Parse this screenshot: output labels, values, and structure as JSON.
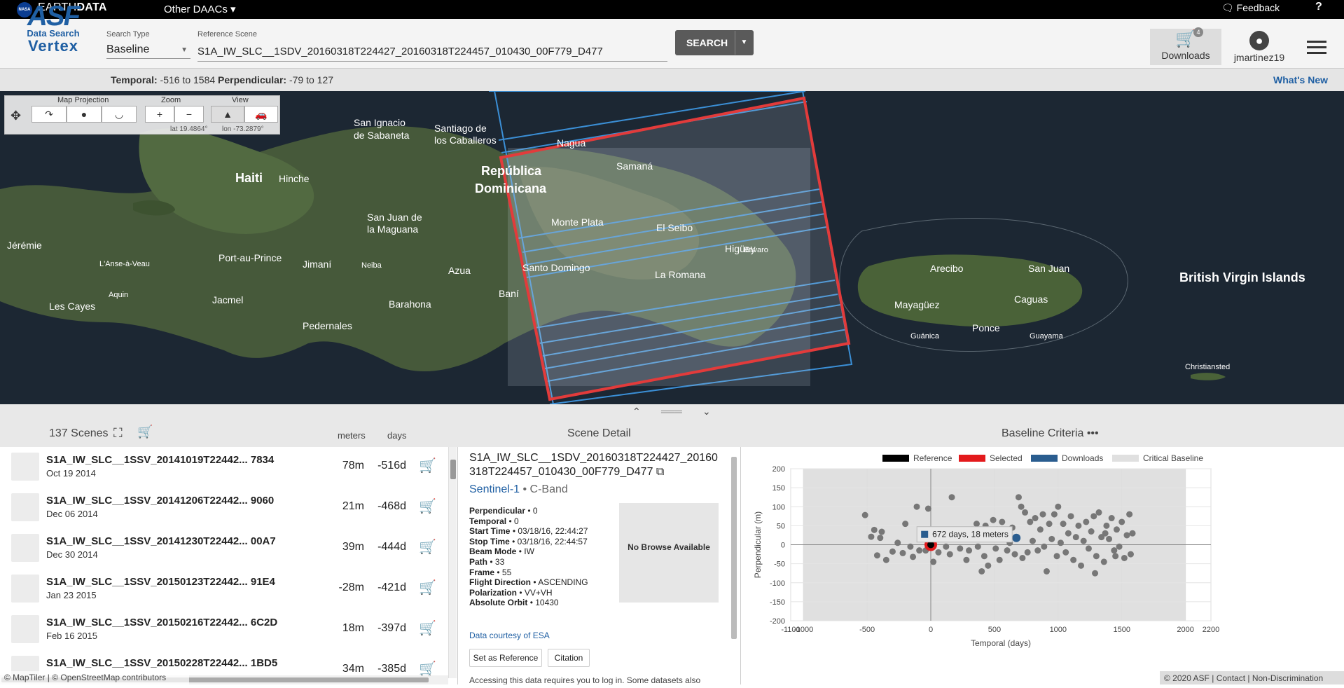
{
  "topbar": {
    "brand_prefix": "EARTH",
    "brand_suffix": "DATA",
    "other_daacs": "Other DAACs ▾",
    "feedback": "Feedback",
    "help": "?",
    "nasa": "NASA"
  },
  "logo": {
    "asf": "ASF",
    "data_search": "Data Search",
    "vertex": "Vertex"
  },
  "search": {
    "type_label": "Search Type",
    "type_value": "Baseline",
    "ref_label": "Reference Scene",
    "ref_value": "S1A_IW_SLC__1SDV_20160318T224427_20160318T224457_010430_00F779_D477",
    "search_button": "SEARCH"
  },
  "downloads": {
    "label": "Downloads",
    "count": "4"
  },
  "user": {
    "name": "jmartinez19"
  },
  "criteria": {
    "temporal_label": "Temporal:",
    "temporal_value": "-516 to 1584",
    "perp_label": "Perpendicular:",
    "perp_value": "-79 to 127",
    "whats_new": "What's New"
  },
  "map": {
    "tools": {
      "projection_label": "Map Projection",
      "zoom_label": "Zoom",
      "view_label": "View",
      "lat": "lat 19.4864°",
      "lon": "lon -73.2879°"
    },
    "places": [
      "Haiti",
      "Hinche",
      "San Ignacio de Sabaneta",
      "Santiago de los Caballeros",
      "Nagua",
      "República Dominicana",
      "Samaná",
      "Monte Plata",
      "El Seibo",
      "Higüey",
      "Bávaro",
      "La Romana",
      "Santo Domingo",
      "Azua",
      "Baní",
      "Barahona",
      "Pedernales",
      "San Juan de la Maguana",
      "Jimaní",
      "Neiba",
      "Port-au-Prince",
      "Jacmel",
      "Les Cayes",
      "Jérémie",
      "L'Anse-à-Veau",
      "Aquin",
      "Arecibo",
      "San Juan",
      "Mayagüez",
      "Caguas",
      "Ponce",
      "Guánica",
      "Guayama",
      "British Virgin Islands",
      "Christiansted"
    ],
    "attribution": "© MapTiler | © OpenStreetMap contributors"
  },
  "results": {
    "count_label": "137 Scenes",
    "col_meters": "meters",
    "col_days": "days",
    "rows": [
      {
        "name": "S1A_IW_SLC__1SSV_20141019T22442... 7834",
        "date": "Oct 19 2014",
        "meters": "78m",
        "days": "-516d"
      },
      {
        "name": "S1A_IW_SLC__1SSV_20141206T22442... 9060",
        "date": "Dec 06 2014",
        "meters": "21m",
        "days": "-468d"
      },
      {
        "name": "S1A_IW_SLC__1SSV_20141230T22442... 00A7",
        "date": "Dec 30 2014",
        "meters": "39m",
        "days": "-444d"
      },
      {
        "name": "S1A_IW_SLC__1SSV_20150123T22442... 91E4",
        "date": "Jan 23 2015",
        "meters": "-28m",
        "days": "-421d"
      },
      {
        "name": "S1A_IW_SLC__1SSV_20150216T22442... 6C2D",
        "date": "Feb 16 2015",
        "meters": "18m",
        "days": "-397d"
      },
      {
        "name": "S1A_IW_SLC__1SSV_20150228T22442... 1BD5",
        "date": "",
        "meters": "34m",
        "days": "-385d"
      }
    ]
  },
  "detail": {
    "header": "Scene Detail",
    "scene_name": "S1A_IW_SLC__1SDV_20160318T224427_20160318T224457_010430_00F779_D477",
    "dataset": "Sentinel-1",
    "band": "• C-Band",
    "fields": [
      {
        "k": "Perpendicular",
        "v": "• 0"
      },
      {
        "k": "Temporal",
        "v": "• 0"
      },
      {
        "k": "Start Time",
        "v": "• 03/18/16, 22:44:27"
      },
      {
        "k": "Stop Time",
        "v": "• 03/18/16, 22:44:57"
      },
      {
        "k": "Beam Mode",
        "v": "• IW"
      },
      {
        "k": "Path",
        "v": "• 33"
      },
      {
        "k": "Frame",
        "v": "• 55"
      },
      {
        "k": "Flight Direction",
        "v": "• ASCENDING"
      },
      {
        "k": "Polarization",
        "v": "• VV+VH"
      },
      {
        "k": "Absolute Orbit",
        "v": "• 10430"
      }
    ],
    "courtesy": "Data courtesy of ESA",
    "no_browse": "No Browse Available",
    "set_reference": "Set as Reference",
    "citation": "Citation",
    "access_note": "Accessing this data requires you to log in. Some datasets also"
  },
  "baseline": {
    "header": "Baseline Criteria •••"
  },
  "colors": {
    "reference": "#000000",
    "selected": "#e31a1c",
    "downloads": "#2a5d8f",
    "critical": "#e0e0e0",
    "accent": "#1f5fa3"
  },
  "chart_data": {
    "type": "scatter",
    "xlabel": "Temporal (days)",
    "ylabel": "Perpendicular (m)",
    "xlim": [
      -1100,
      2200
    ],
    "ylim": [
      -200,
      200
    ],
    "xticks": [
      "-1100",
      "-1000",
      "-500",
      "0",
      "500",
      "1000",
      "1500",
      "2000",
      "2200"
    ],
    "yticks": [
      "200",
      "150",
      "100",
      "50",
      "0",
      "-50",
      "-100",
      "-150",
      "-200"
    ],
    "legend": [
      "Reference",
      "Selected",
      "Downloads",
      "Critical Baseline"
    ],
    "tooltip": "672 days, 18 meters",
    "reference": {
      "x": 0,
      "y": 0
    },
    "selected": {
      "x": 0,
      "y": 0
    },
    "downloads": [
      {
        "x": 672,
        "y": 18
      }
    ],
    "points": [
      [
        -516,
        78
      ],
      [
        -468,
        21
      ],
      [
        -444,
        39
      ],
      [
        -421,
        -28
      ],
      [
        -397,
        18
      ],
      [
        -385,
        34
      ],
      [
        -350,
        -40
      ],
      [
        -300,
        -18
      ],
      [
        -260,
        5
      ],
      [
        -220,
        -22
      ],
      [
        -200,
        55
      ],
      [
        -160,
        -5
      ],
      [
        -140,
        -32
      ],
      [
        -110,
        100
      ],
      [
        -90,
        -15
      ],
      [
        -60,
        25
      ],
      [
        -40,
        -15
      ],
      [
        -20,
        95
      ],
      [
        20,
        -45
      ],
      [
        60,
        -20
      ],
      [
        80,
        20
      ],
      [
        120,
        -5
      ],
      [
        150,
        -25
      ],
      [
        165,
        125
      ],
      [
        200,
        35
      ],
      [
        230,
        -10
      ],
      [
        260,
        15
      ],
      [
        280,
        -40
      ],
      [
        300,
        -15
      ],
      [
        330,
        20
      ],
      [
        360,
        55
      ],
      [
        370,
        -5
      ],
      [
        390,
        35
      ],
      [
        400,
        -70
      ],
      [
        420,
        -30
      ],
      [
        430,
        50
      ],
      [
        450,
        -55
      ],
      [
        470,
        25
      ],
      [
        490,
        65
      ],
      [
        510,
        -10
      ],
      [
        520,
        40
      ],
      [
        540,
        -40
      ],
      [
        560,
        60
      ],
      [
        580,
        25
      ],
      [
        600,
        -15
      ],
      [
        620,
        5
      ],
      [
        640,
        45
      ],
      [
        660,
        -25
      ],
      [
        690,
        125
      ],
      [
        710,
        100
      ],
      [
        720,
        -35
      ],
      [
        740,
        85
      ],
      [
        760,
        -20
      ],
      [
        780,
        60
      ],
      [
        800,
        10
      ],
      [
        820,
        70
      ],
      [
        840,
        -15
      ],
      [
        860,
        40
      ],
      [
        880,
        80
      ],
      [
        890,
        -5
      ],
      [
        910,
        -70
      ],
      [
        930,
        55
      ],
      [
        950,
        15
      ],
      [
        970,
        80
      ],
      [
        990,
        -30
      ],
      [
        1000,
        100
      ],
      [
        1020,
        5
      ],
      [
        1040,
        55
      ],
      [
        1060,
        -20
      ],
      [
        1080,
        30
      ],
      [
        1100,
        75
      ],
      [
        1120,
        -40
      ],
      [
        1140,
        20
      ],
      [
        1160,
        50
      ],
      [
        1180,
        -55
      ],
      [
        1200,
        10
      ],
      [
        1220,
        60
      ],
      [
        1240,
        -10
      ],
      [
        1260,
        35
      ],
      [
        1280,
        75
      ],
      [
        1300,
        -30
      ],
      [
        1320,
        85
      ],
      [
        1340,
        20
      ],
      [
        1360,
        -45
      ],
      [
        1380,
        50
      ],
      [
        1400,
        15
      ],
      [
        1420,
        70
      ],
      [
        1440,
        -15
      ],
      [
        1460,
        40
      ],
      [
        1480,
        -5
      ],
      [
        1500,
        60
      ],
      [
        1520,
        -35
      ],
      [
        1540,
        25
      ],
      [
        1560,
        80
      ],
      [
        1584,
        30
      ],
      [
        1570,
        -25
      ],
      [
        1290,
        -75
      ],
      [
        1450,
        -30
      ],
      [
        1370,
        30
      ]
    ]
  }
}
